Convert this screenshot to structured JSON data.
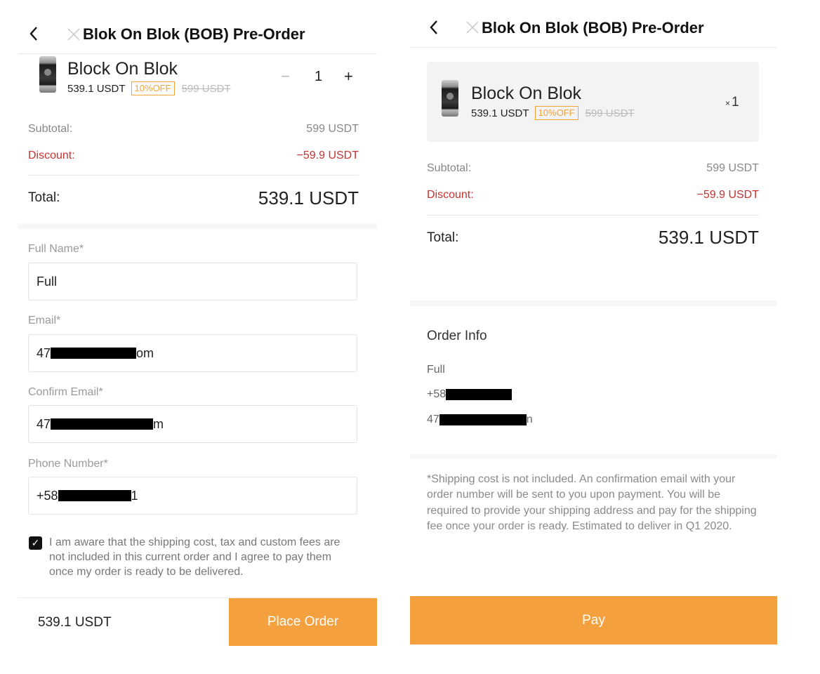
{
  "left": {
    "title": "Blok On Blok (BOB) Pre-Order",
    "product": {
      "name": "Block On Blok",
      "price": "539.1 USDT",
      "badge": "10%OFF",
      "original_price": "599 USDT",
      "qty_minus": "−",
      "quantity": "1",
      "qty_plus": "+"
    },
    "subtotal_label": "Subtotal:",
    "subtotal_value": "599 USDT",
    "discount_label": "Discount:",
    "discount_value": "−59.9 USDT",
    "total_label": "Total:",
    "total_value": "539.1 USDT",
    "form": {
      "full_name_label": "Full Name*",
      "full_name_value": "Full",
      "email_label": "Email*",
      "email_prefix": "47",
      "email_suffix": "om",
      "confirm_email_label": "Confirm Email*",
      "confirm_email_prefix": "47",
      "confirm_email_suffix": "m",
      "phone_label": "Phone Number*",
      "phone_prefix": "+58",
      "phone_suffix": "1"
    },
    "agree_text": "I am aware that the shipping cost, tax and custom fees are not included in this current order and I agree to pay them once my order is ready to be delivered.",
    "bottom_price": "539.1 USDT",
    "place_order_label": "Place Order"
  },
  "right": {
    "title": "Blok On Blok (BOB) Pre-Order",
    "product": {
      "name": "Block On Blok",
      "price": "539.1 USDT",
      "badge": "10%OFF",
      "original_price": "599 USDT",
      "qty_x": "×",
      "quantity": "1"
    },
    "subtotal_label": "Subtotal:",
    "subtotal_value": "599 USDT",
    "discount_label": "Discount:",
    "discount_value": "−59.9 USDT",
    "total_label": "Total:",
    "total_value": "539.1 USDT",
    "order_info_title": "Order Info",
    "info_name": "Full",
    "info_phone_prefix": "+58",
    "info_email_prefix": "47",
    "info_email_suffix": "n",
    "note": "*Shipping cost is not included. An confirmation email with your order number will be sent to you upon payment. You will be required to provide your shipping address and pay for the shipping fee once your order is ready. Estimated to deliver in Q1 2020.",
    "pay_label": "Pay"
  },
  "colors": {
    "accent": "#f5a03f",
    "discount": "#c8322f",
    "badge": "#f3a33a"
  },
  "icons": {
    "back": "chevron-left-icon",
    "close": "close-icon",
    "check": "checkbox-checked-icon"
  }
}
